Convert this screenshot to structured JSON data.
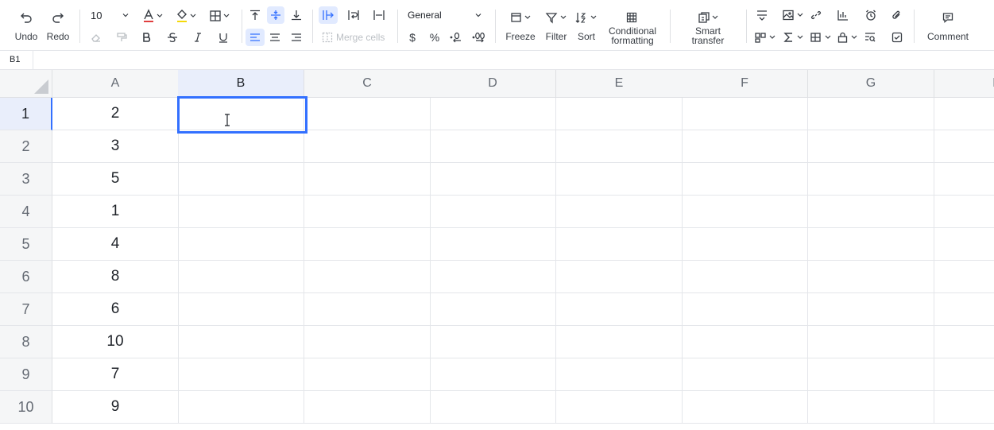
{
  "toolbar": {
    "undo_label": "Undo",
    "redo_label": "Redo",
    "font_size": "10",
    "merge_label": "Merge cells",
    "number_format": "General",
    "currency_symbol": "$",
    "percent_symbol": "%",
    "freeze_label": "Freeze",
    "filter_label": "Filter",
    "sort_label": "Sort",
    "cond_format_line1": "Conditional",
    "cond_format_line2": "formatting",
    "smart_line1": "Smart",
    "smart_line2": "transfer",
    "comment_label": "Comment",
    "font_color": "#e03e3e",
    "fill_color": "#f5d90a"
  },
  "formula_bar": {
    "cell_ref": "B1"
  },
  "sheet": {
    "columns": [
      "A",
      "B",
      "C",
      "D",
      "E",
      "F",
      "G",
      "H"
    ],
    "rows": [
      "1",
      "2",
      "3",
      "4",
      "5",
      "6",
      "7",
      "8",
      "9",
      "10"
    ],
    "colA_values": [
      "2",
      "3",
      "5",
      "1",
      "4",
      "8",
      "6",
      "10",
      "7",
      "9"
    ],
    "selected_cell": "B1"
  },
  "colors": {
    "accent": "#3370ff",
    "header_bg": "#f5f6f7",
    "selected_header_bg": "#e9eefb"
  }
}
